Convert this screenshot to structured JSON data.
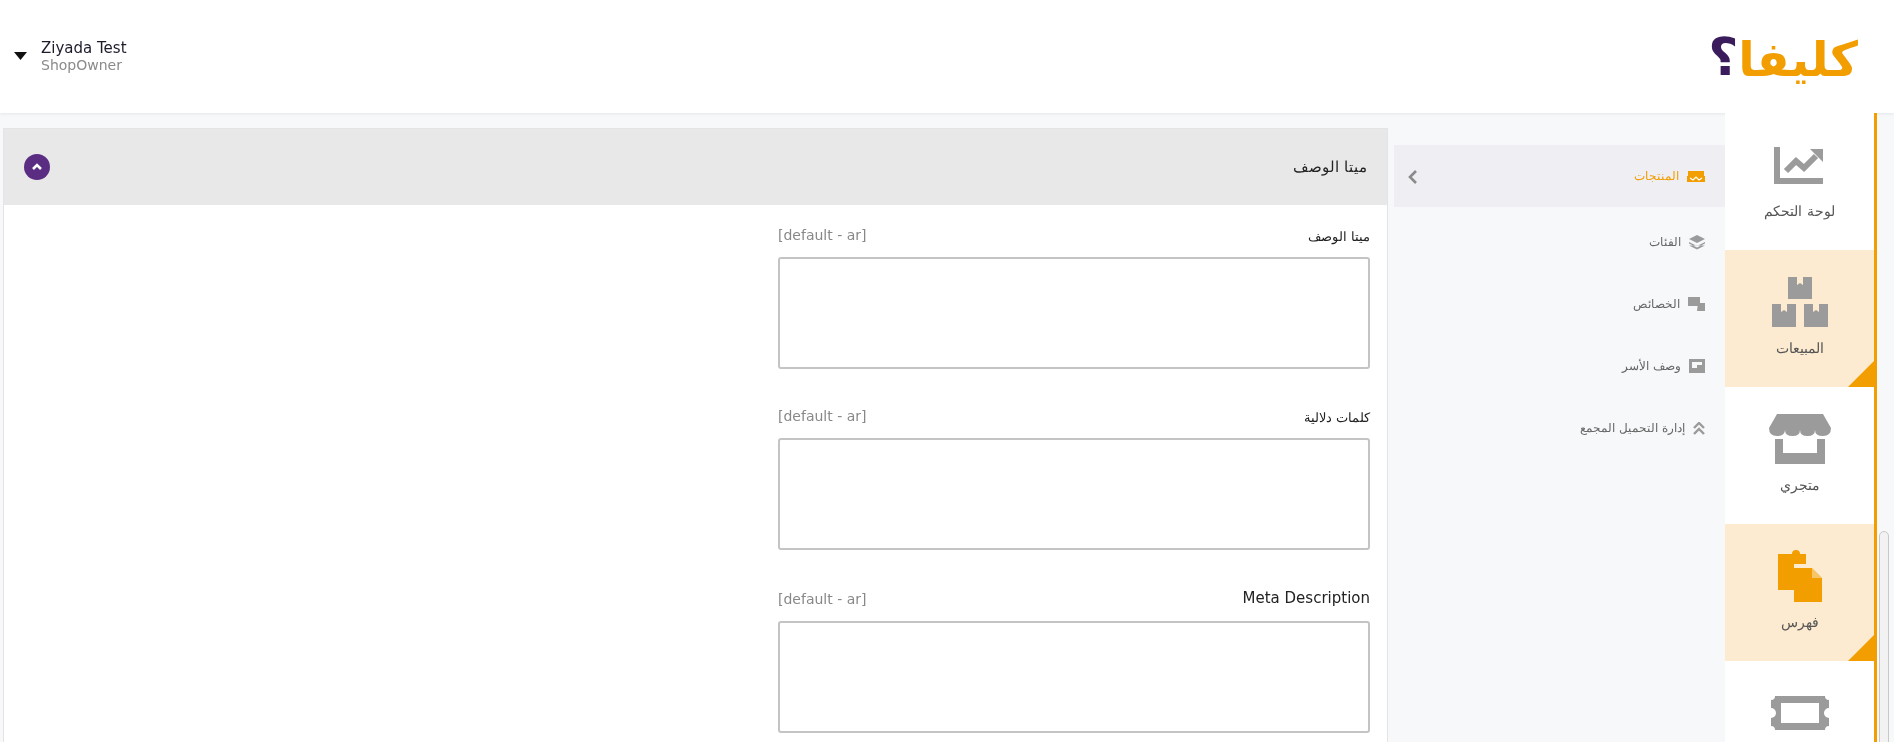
{
  "user": {
    "name": "Ziyada Test",
    "role": "ShopOwner"
  },
  "logo": {
    "text": "كليفا",
    "mark": "؟"
  },
  "panel": {
    "title": "ميتا الوصف",
    "expanded": true,
    "fields": [
      {
        "label": "ميتا الوصف",
        "hint": "[default - ar]"
      },
      {
        "label": "كلمات دلالية",
        "hint": "[default - ar]"
      },
      {
        "label": "Meta Description",
        "hint": "[default - ar]"
      }
    ]
  },
  "submenu": {
    "items": [
      {
        "label": "المنتجات",
        "selected": true
      },
      {
        "label": "الفئات",
        "selected": false
      },
      {
        "label": "الخصائص",
        "selected": false
      },
      {
        "label": "وصف الأسر",
        "selected": false
      },
      {
        "label": "إدارة التحميل المجمع",
        "selected": false
      }
    ]
  },
  "rail": {
    "items": [
      {
        "label": "لوحة التحكم",
        "selected": false,
        "has_submenu": false
      },
      {
        "label": "المبيعات",
        "selected": false,
        "has_submenu": true
      },
      {
        "label": "متجري",
        "selected": false,
        "has_submenu": false
      },
      {
        "label": "فهرس",
        "selected": true,
        "has_submenu": true
      },
      {
        "selected": false,
        "has_submenu": false
      }
    ]
  }
}
